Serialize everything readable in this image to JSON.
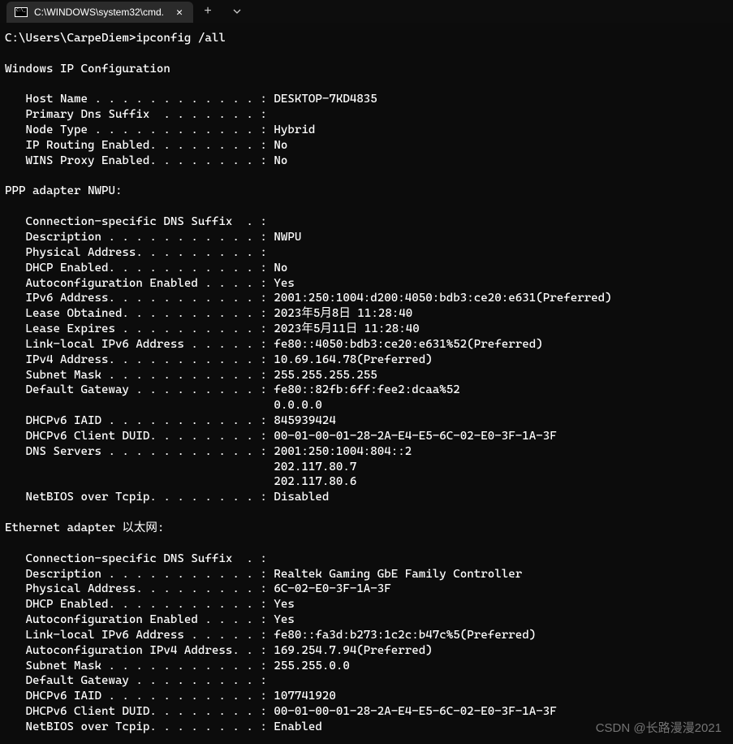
{
  "tab": {
    "title": "C:\\WINDOWS\\system32\\cmd."
  },
  "prompt": "C:\\Users\\CarpeDiem>",
  "command": "ipconfig /all",
  "header": "Windows IP Configuration",
  "global": {
    "host_name_label": "   Host Name . . . . . . . . . . . . : ",
    "host_name": "DESKTOP-7KD4835",
    "primary_dns_suffix_label": "   Primary Dns Suffix  . . . . . . . :",
    "node_type_label": "   Node Type . . . . . . . . . . . . : ",
    "node_type": "Hybrid",
    "ip_routing_label": "   IP Routing Enabled. . . . . . . . : ",
    "ip_routing": "No",
    "wins_proxy_label": "   WINS Proxy Enabled. . . . . . . . : ",
    "wins_proxy": "No"
  },
  "adapter1": {
    "title": "PPP adapter NWPU:",
    "conn_suffix_label": "   Connection-specific DNS Suffix  . :",
    "description_label": "   Description . . . . . . . . . . . : ",
    "description": "NWPU",
    "phys_addr_label": "   Physical Address. . . . . . . . . :",
    "dhcp_enabled_label": "   DHCP Enabled. . . . . . . . . . . : ",
    "dhcp_enabled": "No",
    "autoconfig_label": "   Autoconfiguration Enabled . . . . : ",
    "autoconfig": "Yes",
    "ipv6_label": "   IPv6 Address. . . . . . . . . . . : ",
    "ipv6": "2001:250:1004:d200:4050:bdb3:ce20:e631(Preferred)",
    "lease_obt_label": "   Lease Obtained. . . . . . . . . . : ",
    "lease_obt": "2023年5月8日 11:28:40",
    "lease_exp_label": "   Lease Expires . . . . . . . . . . : ",
    "lease_exp": "2023年5月11日 11:28:40",
    "link_local_label": "   Link-local IPv6 Address . . . . . : ",
    "link_local": "fe80::4050:bdb3:ce20:e631%52(Preferred)",
    "ipv4_label": "   IPv4 Address. . . . . . . . . . . : ",
    "ipv4": "10.69.164.78(Preferred)",
    "subnet_label": "   Subnet Mask . . . . . . . . . . . : ",
    "subnet": "255.255.255.255",
    "gateway_label": "   Default Gateway . . . . . . . . . : ",
    "gateway": "fe80::82fb:6ff:fee2:dcaa%52",
    "gateway2_label": "                                       ",
    "gateway2": "0.0.0.0",
    "iaid_label": "   DHCPv6 IAID . . . . . . . . . . . : ",
    "iaid": "845939424",
    "duid_label": "   DHCPv6 Client DUID. . . . . . . . : ",
    "duid": "00-01-00-01-28-2A-E4-E5-6C-02-E0-3F-1A-3F",
    "dns_label": "   DNS Servers . . . . . . . . . . . : ",
    "dns1": "2001:250:1004:804::2",
    "dns2_label": "                                       ",
    "dns2": "202.117.80.7",
    "dns3_label": "                                       ",
    "dns3": "202.117.80.6",
    "netbios_label": "   NetBIOS over Tcpip. . . . . . . . : ",
    "netbios": "Disabled"
  },
  "adapter2": {
    "title": "Ethernet adapter 以太网:",
    "conn_suffix_label": "   Connection-specific DNS Suffix  . :",
    "description_label": "   Description . . . . . . . . . . . : ",
    "description": "Realtek Gaming GbE Family Controller",
    "phys_addr_label": "   Physical Address. . . . . . . . . : ",
    "phys_addr": "6C-02-E0-3F-1A-3F",
    "dhcp_enabled_label": "   DHCP Enabled. . . . . . . . . . . : ",
    "dhcp_enabled": "Yes",
    "autoconfig_label": "   Autoconfiguration Enabled . . . . : ",
    "autoconfig": "Yes",
    "link_local_label": "   Link-local IPv6 Address . . . . . : ",
    "link_local": "fe80::fa3d:b273:1c2c:b47c%5(Preferred)",
    "autov4_label": "   Autoconfiguration IPv4 Address. . : ",
    "autov4": "169.254.7.94(Preferred)",
    "subnet_label": "   Subnet Mask . . . . . . . . . . . : ",
    "subnet": "255.255.0.0",
    "gateway_label": "   Default Gateway . . . . . . . . . :",
    "iaid_label": "   DHCPv6 IAID . . . . . . . . . . . : ",
    "iaid": "107741920",
    "duid_label": "   DHCPv6 Client DUID. . . . . . . . : ",
    "duid": "00-01-00-01-28-2A-E4-E5-6C-02-E0-3F-1A-3F",
    "netbios_label": "   NetBIOS over Tcpip. . . . . . . . : ",
    "netbios": "Enabled"
  },
  "watermark": "CSDN @长路漫漫2021"
}
